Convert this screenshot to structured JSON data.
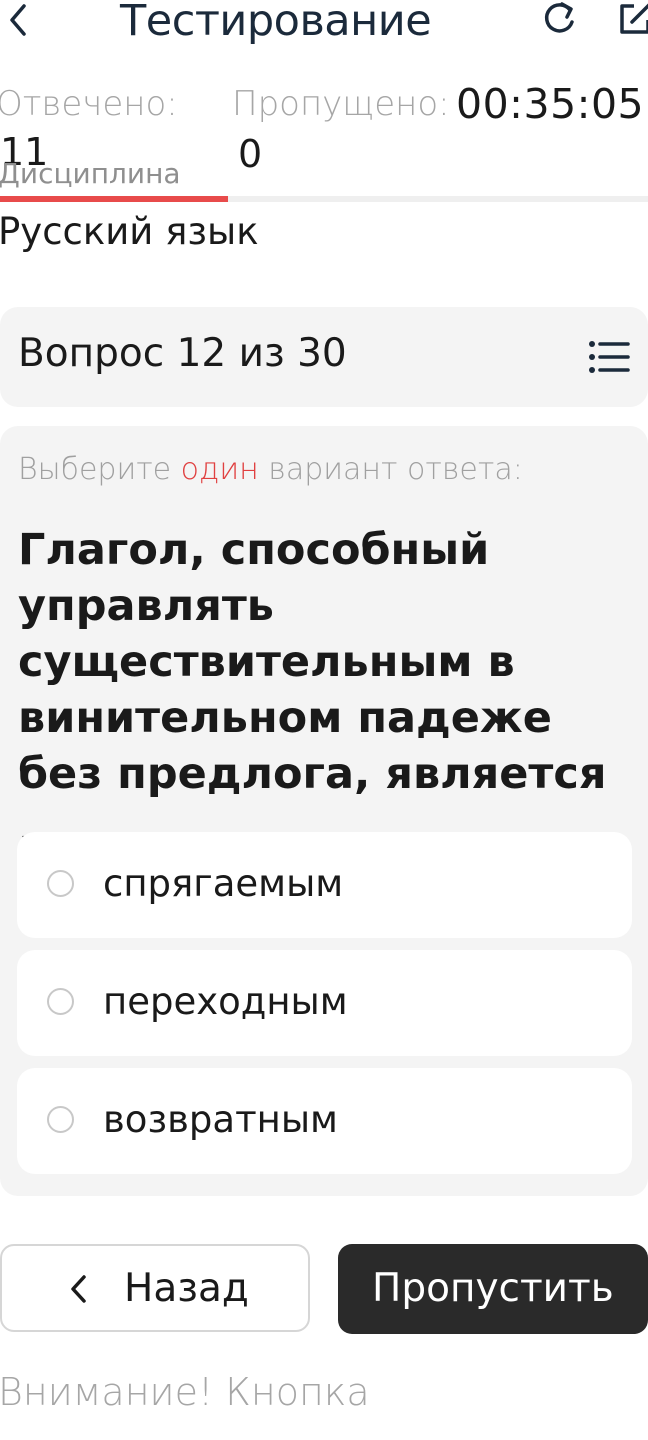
{
  "header": {
    "title": "Тестирование",
    "back_icon": "chevron-left-icon",
    "refresh_icon": "refresh-icon",
    "external_icon": "external-link-icon"
  },
  "stats": {
    "answered_label": "Отвечено:",
    "answered_value": "11",
    "skipped_label": "Пропущено:",
    "skipped_value": "0",
    "timer": "00:35:05"
  },
  "tab": {
    "label": "Дисциплина",
    "accent_color": "#e84b4b"
  },
  "discipline": {
    "name": "Русский язык"
  },
  "question": {
    "counter": "Вопрос 12 из 30",
    "list_icon": "list-icon",
    "instruction_before": "Выберите ",
    "instruction_accent": "один",
    "instruction_after": " вариант ответа:",
    "text": "Глагол, способный управлять существительным в винительном падеже без предлога, является ...",
    "options": [
      {
        "label": "спрягаемым",
        "selected": false
      },
      {
        "label": "переходным",
        "selected": false
      },
      {
        "label": "возвратным",
        "selected": false
      }
    ]
  },
  "buttons": {
    "back_label": "Назад",
    "skip_label": "Пропустить"
  },
  "warning": "Внимание! Кнопка"
}
